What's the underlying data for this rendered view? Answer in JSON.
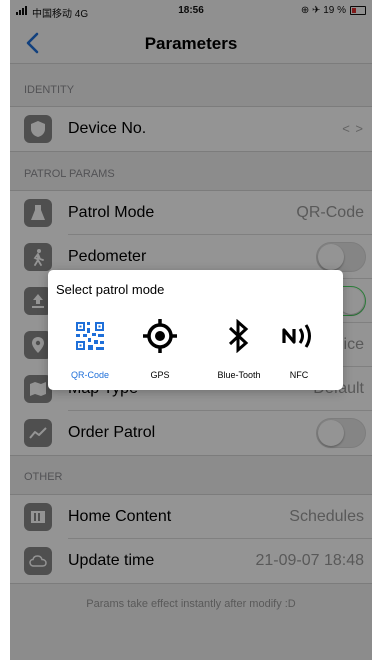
{
  "status_bar": {
    "carrier": "中国移动 4G",
    "time": "18:56",
    "right_indicators": "⊕ ✈ 19 %"
  },
  "nav": {
    "title": "Parameters",
    "back_icon": "chevron-left-icon"
  },
  "sections": {
    "identity": "IDENTITY",
    "patrol_params": "PATROL PARAMS",
    "other": "OTHER"
  },
  "identity_rows": [
    {
      "icon": "shield-icon",
      "label": "Device No.",
      "value": "< >"
    }
  ],
  "patrol_rows": [
    {
      "icon": "flask-icon",
      "label": "Patrol Mode",
      "value": "QR-Code"
    },
    {
      "icon": "walking-icon",
      "label": "Pedometer",
      "toggle": false
    },
    {
      "icon": "upload-icon",
      "label": "",
      "toggle": true
    },
    {
      "icon": "pin-icon",
      "label": "",
      "value": "ice"
    },
    {
      "icon": "map-icon",
      "label": "Map Type",
      "value": "Default"
    },
    {
      "icon": "trend-icon",
      "label": "Order Patrol",
      "toggle": false
    }
  ],
  "other_rows": [
    {
      "icon": "list-icon",
      "label": "Home Content",
      "value": "Schedules"
    },
    {
      "icon": "cloud-icon",
      "label": "Update time",
      "value": "21-09-07 18:48"
    }
  ],
  "footer_note": "Params take effect instantly after modify :D",
  "dialog": {
    "title": "Select patrol mode",
    "selected": "QR-Code",
    "options": [
      {
        "label": "QR-Code",
        "icon": "qr-code-icon"
      },
      {
        "label": "GPS",
        "icon": "gps-icon"
      },
      {
        "label": "Blue-Tooth",
        "icon": "bluetooth-icon"
      },
      {
        "label": "NFC",
        "icon": "nfc-icon"
      }
    ]
  },
  "colors": {
    "accent": "#1e6fd9",
    "toggle_on": "#4cd964",
    "overlay": "rgba(0,0,0,0.42)"
  }
}
